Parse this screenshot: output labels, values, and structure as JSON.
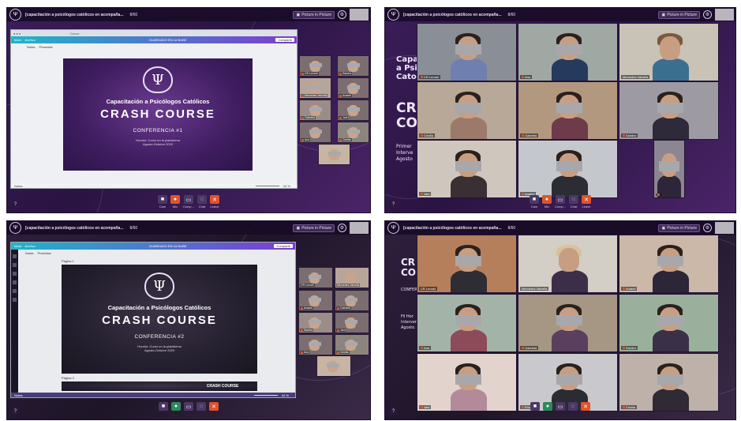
{
  "meeting": {
    "title": "[capacitación a psicólogos católicos en acompaña...",
    "title_short": "[capacitación a psicólogos católicos en acompaña...",
    "participants": "8/60",
    "pip_label": "Picture in Picture"
  },
  "controls": {
    "labels": [
      "Cam",
      "Mic",
      "Comp...",
      "Chat",
      "Leave"
    ]
  },
  "slide1": {
    "subtitle": "Capacitación a Psicólogos Católicos",
    "title": "CRASH COURSE",
    "conference": "CONFERENCIA #1",
    "line1": "Horario: Curso en la plataforma",
    "line2": "Agosto-Octubre 2020"
  },
  "slide2": {
    "subtitle": "Capacitación a Psicólogos Católicos",
    "title": "CRASH COURSE",
    "conference": "CONFERENCIA #2",
    "line1": "Horario: Curso en la plataforma",
    "line2": "Agosto-Octubre 2020",
    "next_title": "CRASH COURSE"
  },
  "panel2_text": {
    "big1": "Capac",
    "big2": "a Psic",
    "big3": "Catoc",
    "cr": "CR",
    "co": "CO",
    "p1": "Primer",
    "p2": "Interve",
    "p3": "Agosto"
  },
  "panel4_text": {
    "cr": "CR",
    "co": "CO",
    "conf": "CONFERENCIA #2",
    "p1": "Fil Hor",
    "p2": "Interven",
    "p3": "Agosto"
  },
  "thumbs1": [
    "CR Leonel",
    "Sandra",
    "Mercedes Valvella",
    "Anabel",
    "Gabriela",
    "Jani",
    "Ana",
    "Cecilia"
  ],
  "thumbs3": [
    "CR Leonel",
    "Mercedes Valvella",
    "Anabel",
    "Gabriela",
    "Sandra",
    "Jani",
    "Ana",
    "Cecilia"
  ],
  "gallery2": [
    "CR Leonel",
    "Ana",
    "Mercedes Valvella",
    "Cecilia",
    "Gabriela",
    "Sandra",
    "Jani",
    "Anabel",
    "Rosa"
  ],
  "gallery4": [
    "CR Leonel",
    "Mercedes Valvella",
    "Anabel",
    "Ana",
    "Gabriela",
    "Sandra",
    "Jani",
    "Rosa",
    "Cecilia"
  ],
  "browser": {
    "tab": "Canva",
    "left_btn1": "Inicio",
    "left_btn2": "Archivo",
    "right_hint": "GUARDADO EN LA NUBE",
    "share": "Compartir",
    "present": "Presentar",
    "notes": "Notas",
    "page_label1": "Página 1",
    "page_label2": "Página 2",
    "zoom": "44 %"
  },
  "colors": {
    "accent": "#e0532b",
    "purple": "#3b1d59"
  }
}
